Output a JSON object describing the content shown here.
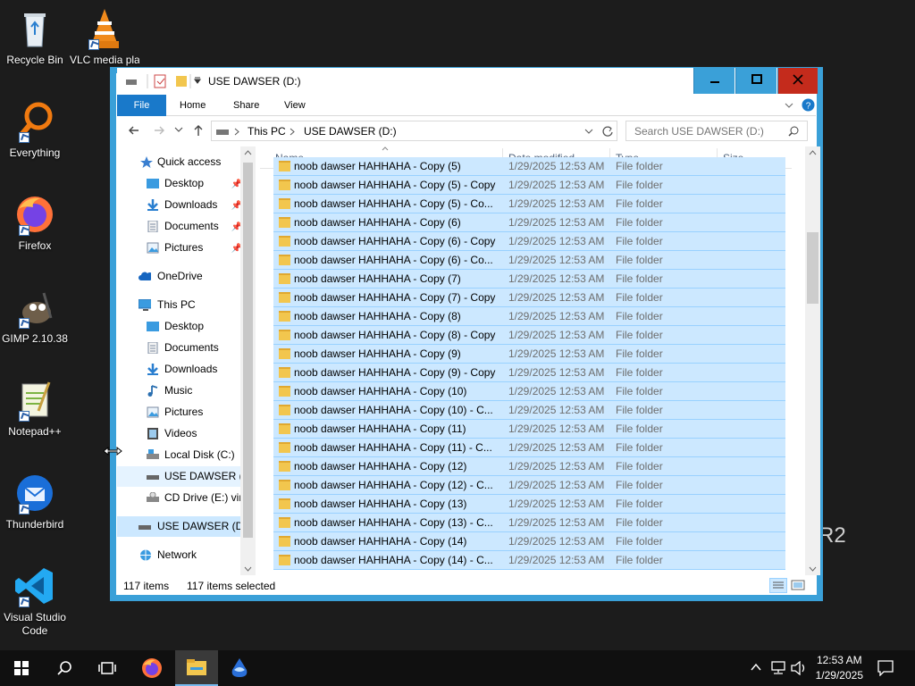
{
  "desktop": {
    "icons": [
      {
        "label": "Recycle Bin"
      },
      {
        "label": "VLC media play"
      },
      {
        "label": "Everything"
      },
      {
        "label": "Firefox"
      },
      {
        "label": "GIMP 2.10.38"
      },
      {
        "label": "Notepad++"
      },
      {
        "label": "Thunderbird"
      },
      {
        "label": "Visual Studio Code"
      }
    ],
    "watermark": "R2"
  },
  "window": {
    "title": "USE DAWSER (D:)",
    "ribbon_tabs": [
      "File",
      "Home",
      "Share",
      "View"
    ],
    "address": {
      "this_pc": "This PC",
      "drive": "USE DAWSER (D:)"
    },
    "search_placeholder": "Search USE DAWSER (D:)"
  },
  "nav": {
    "quick_access": "Quick access",
    "qa_items": [
      "Desktop",
      "Downloads",
      "Documents",
      "Pictures"
    ],
    "onedrive": "OneDrive",
    "this_pc": "This PC",
    "pc_items": [
      "Desktop",
      "Documents",
      "Downloads",
      "Music",
      "Pictures",
      "Videos",
      "Local Disk (C:)",
      "USE DAWSER (D:)",
      "CD Drive (E:) virt"
    ],
    "drive": "USE DAWSER (D:)",
    "network": "Network"
  },
  "columns": {
    "name": "Name",
    "date": "Date modified",
    "type": "Type",
    "size": "Size"
  },
  "files": [
    {
      "name": "noob dawser HAHHAHA - Copy (5)",
      "date": "1/29/2025 12:53 AM",
      "type": "File folder"
    },
    {
      "name": "noob dawser HAHHAHA - Copy (5) - Copy",
      "date": "1/29/2025 12:53 AM",
      "type": "File folder"
    },
    {
      "name": "noob dawser HAHHAHA - Copy (5) - Co...",
      "date": "1/29/2025 12:53 AM",
      "type": "File folder"
    },
    {
      "name": "noob dawser HAHHAHA - Copy (6)",
      "date": "1/29/2025 12:53 AM",
      "type": "File folder"
    },
    {
      "name": "noob dawser HAHHAHA - Copy (6) - Copy",
      "date": "1/29/2025 12:53 AM",
      "type": "File folder"
    },
    {
      "name": "noob dawser HAHHAHA - Copy (6) - Co...",
      "date": "1/29/2025 12:53 AM",
      "type": "File folder"
    },
    {
      "name": "noob dawser HAHHAHA - Copy (7)",
      "date": "1/29/2025 12:53 AM",
      "type": "File folder"
    },
    {
      "name": "noob dawser HAHHAHA - Copy (7) - Copy",
      "date": "1/29/2025 12:53 AM",
      "type": "File folder"
    },
    {
      "name": "noob dawser HAHHAHA - Copy (8)",
      "date": "1/29/2025 12:53 AM",
      "type": "File folder"
    },
    {
      "name": "noob dawser HAHHAHA - Copy (8) - Copy",
      "date": "1/29/2025 12:53 AM",
      "type": "File folder"
    },
    {
      "name": "noob dawser HAHHAHA - Copy (9)",
      "date": "1/29/2025 12:53 AM",
      "type": "File folder"
    },
    {
      "name": "noob dawser HAHHAHA - Copy (9) - Copy",
      "date": "1/29/2025 12:53 AM",
      "type": "File folder"
    },
    {
      "name": "noob dawser HAHHAHA - Copy (10)",
      "date": "1/29/2025 12:53 AM",
      "type": "File folder"
    },
    {
      "name": "noob dawser HAHHAHA - Copy (10) - C...",
      "date": "1/29/2025 12:53 AM",
      "type": "File folder"
    },
    {
      "name": "noob dawser HAHHAHA - Copy (11)",
      "date": "1/29/2025 12:53 AM",
      "type": "File folder"
    },
    {
      "name": "noob dawser HAHHAHA - Copy (11) - C...",
      "date": "1/29/2025 12:53 AM",
      "type": "File folder"
    },
    {
      "name": "noob dawser HAHHAHA - Copy (12)",
      "date": "1/29/2025 12:53 AM",
      "type": "File folder"
    },
    {
      "name": "noob dawser HAHHAHA - Copy (12) - C...",
      "date": "1/29/2025 12:53 AM",
      "type": "File folder"
    },
    {
      "name": "noob dawser HAHHAHA - Copy (13)",
      "date": "1/29/2025 12:53 AM",
      "type": "File folder"
    },
    {
      "name": "noob dawser HAHHAHA - Copy (13) - C...",
      "date": "1/29/2025 12:53 AM",
      "type": "File folder"
    },
    {
      "name": "noob dawser HAHHAHA - Copy (14)",
      "date": "1/29/2025 12:53 AM",
      "type": "File folder"
    },
    {
      "name": "noob dawser HAHHAHA - Copy (14) - C...",
      "date": "1/29/2025 12:53 AM",
      "type": "File folder"
    }
  ],
  "status": {
    "count": "117 items",
    "selected": "117 items selected"
  },
  "taskbar": {
    "time": "12:53 AM",
    "date": "1/29/2025"
  },
  "colors": {
    "accent": "#3aa0d8",
    "file_tab": "#1979ca",
    "close": "#c42b1c",
    "selection": "#cce8ff"
  }
}
